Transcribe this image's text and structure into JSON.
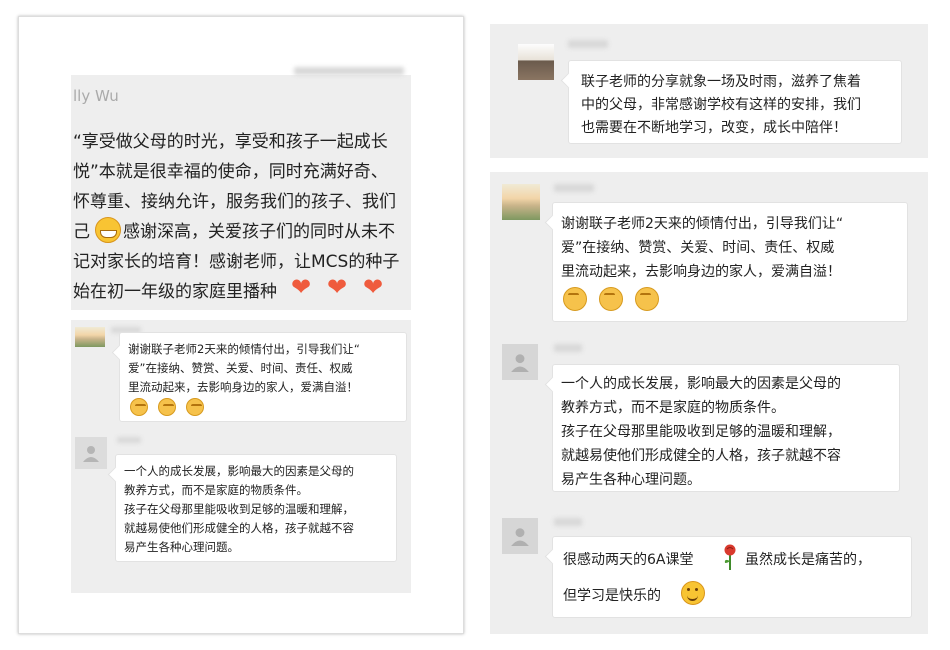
{
  "left": {
    "name_fragment": "lly Wu",
    "main_lines": [
      "“享受做父母的时光，享受和孩子一起成长",
      "悦”本就是很幸福的使命，同时充满好奇、",
      "怀尊重、接纳允许，服务我们的孩子、我们",
      "己",
      "记对家长的培育！感谢老师，让MCS的种子",
      "始在初一年级的家庭里播种"
    ],
    "main_line4_rest": "感谢深高，关爱孩子们的同时从未不",
    "hearts": [
      "❤",
      "❤",
      "❤"
    ],
    "quote1_lines": [
      "谢谢联子老师2天来的倾情付出，引导我们让“",
      "爱”在接纳、赞赏、关爱、时间、责任、权威",
      "里流动起来，去影响身边的家人，爱满自溢！"
    ],
    "quote2_lines": [
      "一个人的成长发展，影响最大的因素是父母的",
      "教养方式，而不是家庭的物质条件。",
      "孩子在父母那里能吸收到足够的温暖和理解，",
      "就越易使他们形成健全的人格，孩子就越不容",
      "易产生各种心理问题。"
    ]
  },
  "right": {
    "msg1_lines": [
      "联子老师的分享就象一场及时雨，滋养了焦着",
      "中的父母，非常感谢学校有这样的安排，我们",
      "也需要在不断地学习，改变，成长中陪伴！"
    ],
    "msg2_lines": [
      "谢谢联子老师2天来的倾情付出，引导我们让“",
      "爱”在接纳、赞赏、关爱、时间、责任、权威",
      "里流动起来，去影响身边的家人，爱满自溢！"
    ],
    "msg3_lines": [
      "一个人的成长发展，影响最大的因素是父母的",
      "教养方式，而不是家庭的物质条件。",
      "孩子在父母那里能吸收到足够的温暖和理解，",
      "就越易使他们形成健全的人格，孩子就越不容",
      "易产生各种心理问题。"
    ],
    "msg4_line1a": "很感动两天的6A课堂",
    "msg4_line1b": "虽然成长是痛苦的，",
    "msg4_line2": "但学习是快乐的"
  }
}
